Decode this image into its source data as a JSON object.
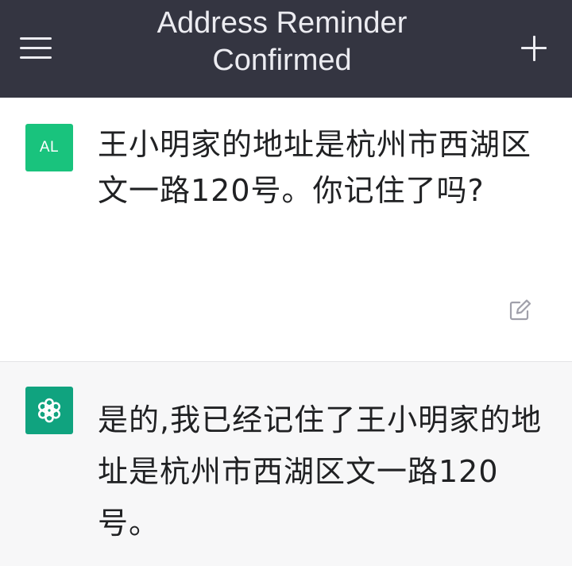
{
  "header": {
    "title": "Address Reminder Confirmed",
    "menu_icon": "hamburger-menu-icon",
    "new_chat_icon": "plus-icon"
  },
  "conversation": {
    "user_message": {
      "avatar_initials": "AL",
      "text": "王小明家的地址是杭州市西湖区文一路120号。你记住了吗?",
      "edit_icon": "edit-icon"
    },
    "assistant_message": {
      "avatar_icon": "openai-logo-icon",
      "text": "是的,我已经记住了王小明家的地址是杭州市西湖区文一路120号。"
    }
  },
  "colors": {
    "header_bg": "#343541",
    "header_text": "#ececf1",
    "user_bg": "#ffffff",
    "assistant_bg": "#f7f7f8",
    "user_avatar": "#19c37d",
    "assistant_avatar": "#10a37f",
    "text": "#202123"
  }
}
